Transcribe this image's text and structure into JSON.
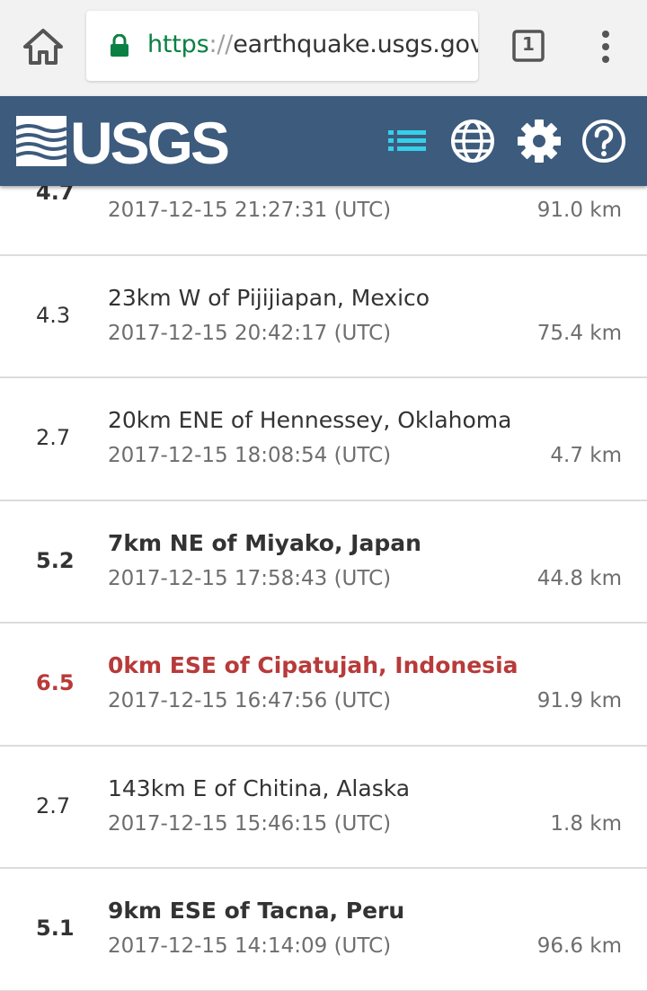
{
  "browser": {
    "url_scheme": "https",
    "url_separator": "://",
    "url_host": "earthquake.usgs.gov/",
    "tab_count": "1"
  },
  "header": {
    "logo_text": "USGS",
    "icons": [
      "list-icon",
      "globe-icon",
      "gear-icon",
      "help-icon"
    ],
    "background": "#3d5b7d",
    "active_icon_color": "#35d0e8"
  },
  "earthquakes": [
    {
      "mag": "4.7",
      "place": "",
      "time": "2017-12-15 21:27:31 (UTC)",
      "depth": "91.0 km",
      "style": "bold"
    },
    {
      "mag": "4.3",
      "place": "23km W of Pijijiapan, Mexico",
      "time": "2017-12-15 20:42:17 (UTC)",
      "depth": "75.4 km",
      "style": "normal"
    },
    {
      "mag": "2.7",
      "place": "20km ENE of Hennessey, Oklahoma",
      "time": "2017-12-15 18:08:54 (UTC)",
      "depth": "4.7 km",
      "style": "normal"
    },
    {
      "mag": "5.2",
      "place": "7km NE of Miyako, Japan",
      "time": "2017-12-15 17:58:43 (UTC)",
      "depth": "44.8 km",
      "style": "bold"
    },
    {
      "mag": "6.5",
      "place": "0km ESE of Cipatujah, Indonesia",
      "time": "2017-12-15 16:47:56 (UTC)",
      "depth": "91.9 km",
      "style": "alert"
    },
    {
      "mag": "2.7",
      "place": "143km E of Chitina, Alaska",
      "time": "2017-12-15 15:46:15 (UTC)",
      "depth": "1.8 km",
      "style": "normal"
    },
    {
      "mag": "5.1",
      "place": "9km ESE of Tacna, Peru",
      "time": "2017-12-15 14:14:09 (UTC)",
      "depth": "96.6 km",
      "style": "bold"
    }
  ],
  "colors": {
    "alert": "#b83a3a",
    "secure_green": "#0b8043"
  }
}
